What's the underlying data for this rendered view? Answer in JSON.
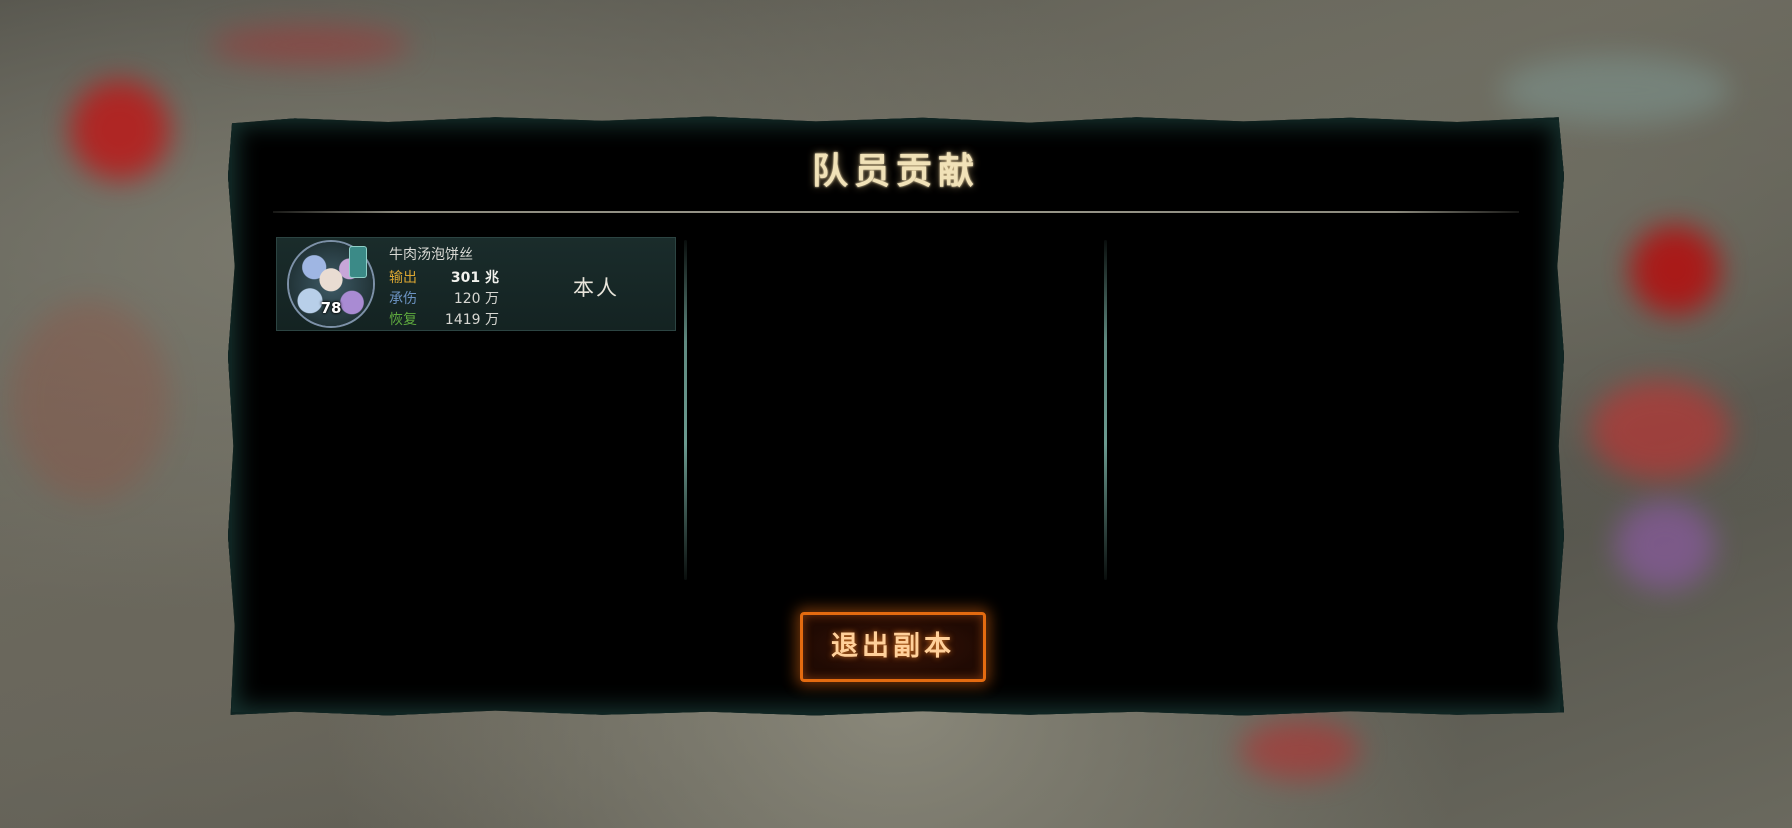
{
  "dialog": {
    "title": "队员贡献"
  },
  "members": [
    {
      "name": "牛肉汤泡饼丝",
      "level": "78",
      "tag": "本人",
      "stats": [
        {
          "label": "输出",
          "value": "301 兆"
        },
        {
          "label": "承伤",
          "value": "120 万"
        },
        {
          "label": "恢复",
          "value": "1419 万"
        }
      ]
    }
  ],
  "exit_button": {
    "label": "退出副本"
  },
  "colors": {
    "title": "#f1e2b8",
    "output_label": "#d9a532",
    "taken_label": "#6c93c2",
    "heal_label": "#5ea93e",
    "button_border": "#e46b10",
    "button_text": "#ffd09a"
  }
}
